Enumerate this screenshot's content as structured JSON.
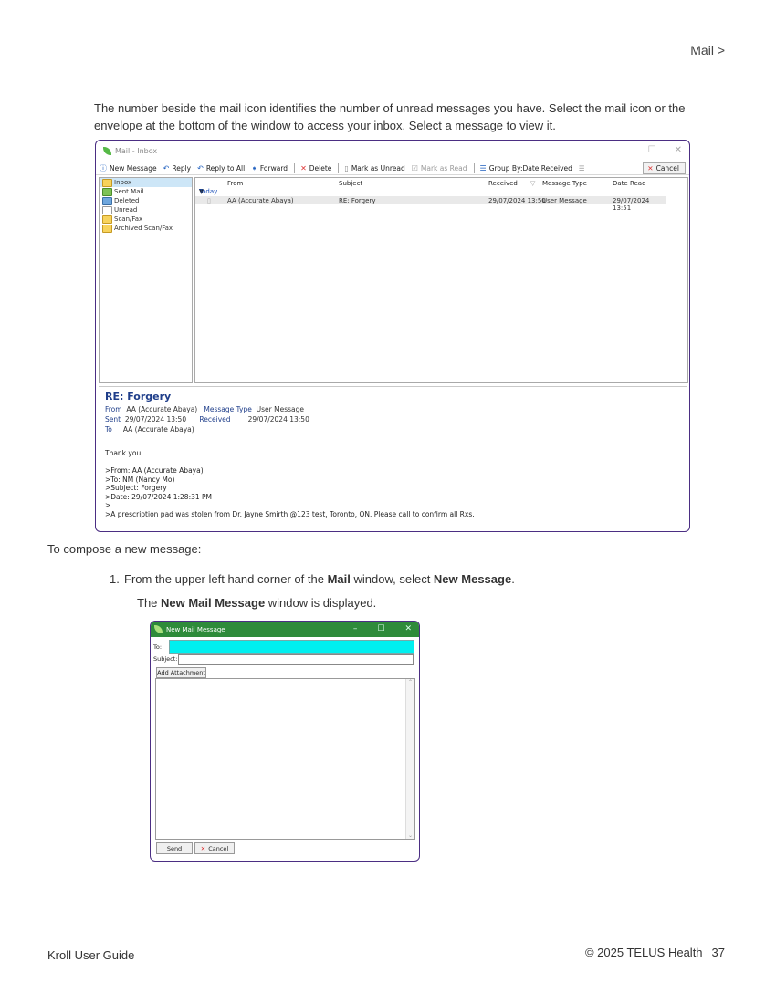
{
  "header": {
    "section": "Mail >"
  },
  "intro": "The number beside the mail icon identifies the number of unread messages you have. Select the mail icon or the envelope at the bottom of the window to access your inbox. Select a message to view it.",
  "mail_window": {
    "title": "Mail - Inbox",
    "toolbar": {
      "new_message": "New Message",
      "reply": "Reply",
      "reply_all": "Reply to All",
      "forward": "Forward",
      "delete": "Delete",
      "mark_unread": "Mark as Unread",
      "mark_read": "Mark as Read",
      "group_by": "Group By:Date Received",
      "cancel": "Cancel"
    },
    "folders": [
      "Inbox",
      "Sent Mail",
      "Deleted",
      "Unread",
      "Scan/Fax",
      "Archived Scan/Fax"
    ],
    "columns": {
      "from": "From",
      "subject": "Subject",
      "received": "Received",
      "message_type": "Message Type",
      "date_read": "Date Read"
    },
    "group": "Today",
    "message": {
      "from": "AA (Accurate Abaya)",
      "subject": "RE: Forgery",
      "received": "29/07/2024 13:50",
      "message_type": "User Message",
      "date_read": "29/07/2024 13:51"
    },
    "preview": {
      "subject": "RE: Forgery",
      "from_label": "From",
      "from": "AA (Accurate Abaya)",
      "type_label": "Message Type",
      "type": "User Message",
      "sent_label": "Sent",
      "sent": "29/07/2024 13:50",
      "received_label": "Received",
      "received": "29/07/2024 13:50",
      "to_label": "To",
      "to": "AA (Accurate Abaya)",
      "body": "Thank you\n\n>From: AA (Accurate Abaya)\n>To: NM (Nancy Mo)\n>Subject: Forgery\n>Date: 29/07/2024 1:28:31 PM\n>\n>A prescription pad was stolen from Dr. Jayne Smirth @123 test, Toronto, ON. Please call to confirm all Rxs."
    }
  },
  "compose_caption": "To compose a new message:",
  "step1": {
    "num": "1.",
    "pre": "From the upper left hand corner of the ",
    "b1": "Mail",
    "mid": " window, select ",
    "b2": "New Message",
    "post": "."
  },
  "step1_result": {
    "pre": "The ",
    "b": "New Mail Message",
    "post": " window is displayed."
  },
  "new_mail": {
    "title": "New Mail Message",
    "to_label": "To:",
    "subject_label": "Subject:",
    "add_attachment": "Add Attachment",
    "send": "Send",
    "cancel": "Cancel"
  },
  "footer": {
    "left": "Kroll User Guide",
    "copyright": "© 2025 TELUS Health",
    "page": "37"
  }
}
